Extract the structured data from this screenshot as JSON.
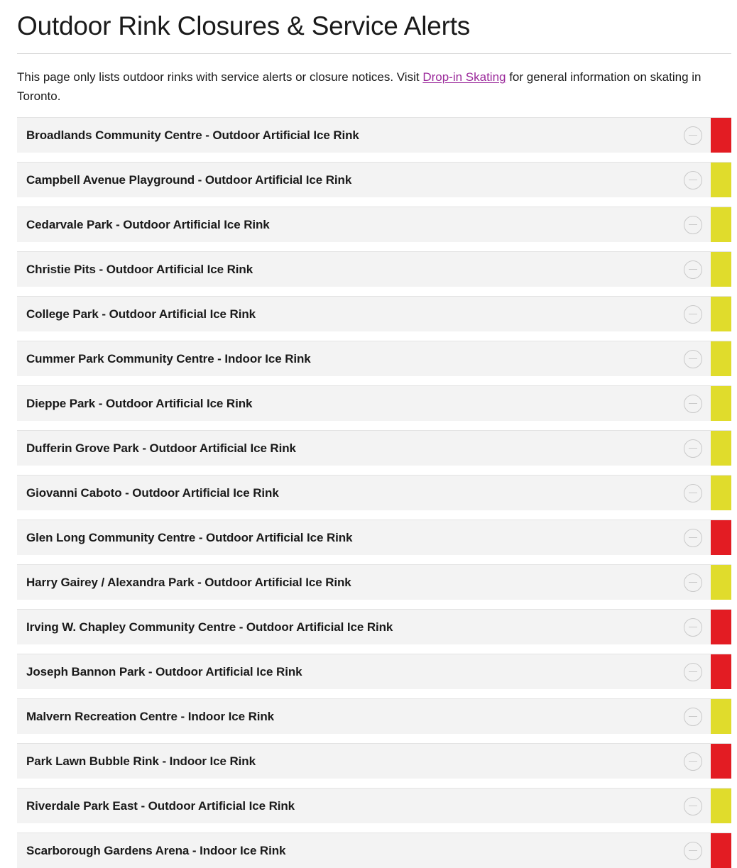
{
  "header": {
    "title": "Outdoor Rink Closures & Service Alerts"
  },
  "intro": {
    "text_before": "This page only lists outdoor rinks with service alerts or closure notices. Visit ",
    "link_label": "Drop-in Skating",
    "text_after": " for general information on skating in Toronto."
  },
  "colors": {
    "red": "#e31c23",
    "yellow": "#e0dc2c",
    "link": "#9b2a9b",
    "row_background": "#f3f3f3",
    "page_background": "#ffffff"
  },
  "icons": {
    "collapse": "minus-circle-icon"
  },
  "rinks": [
    {
      "name": "Broadlands Community Centre - Outdoor Artificial Ice Rink",
      "status": "red"
    },
    {
      "name": "Campbell Avenue Playground - Outdoor Artificial Ice Rink",
      "status": "yellow"
    },
    {
      "name": "Cedarvale Park - Outdoor Artificial Ice Rink",
      "status": "yellow"
    },
    {
      "name": "Christie Pits - Outdoor Artificial Ice Rink",
      "status": "yellow"
    },
    {
      "name": "College Park - Outdoor Artificial Ice Rink",
      "status": "yellow"
    },
    {
      "name": "Cummer Park Community Centre - Indoor Ice Rink",
      "status": "yellow"
    },
    {
      "name": "Dieppe Park - Outdoor Artificial Ice Rink",
      "status": "yellow"
    },
    {
      "name": "Dufferin Grove Park - Outdoor Artificial Ice Rink",
      "status": "yellow"
    },
    {
      "name": "Giovanni Caboto - Outdoor Artificial Ice Rink",
      "status": "yellow"
    },
    {
      "name": "Glen Long Community Centre - Outdoor Artificial Ice Rink",
      "status": "red"
    },
    {
      "name": "Harry Gairey / Alexandra Park - Outdoor Artificial Ice Rink",
      "status": "yellow"
    },
    {
      "name": "Irving W. Chapley Community Centre - Outdoor Artificial Ice Rink",
      "status": "red"
    },
    {
      "name": "Joseph Bannon Park - Outdoor Artificial Ice Rink",
      "status": "red"
    },
    {
      "name": "Malvern Recreation Centre - Indoor Ice Rink",
      "status": "yellow"
    },
    {
      "name": "Park Lawn Bubble Rink - Indoor Ice Rink",
      "status": "red"
    },
    {
      "name": "Riverdale Park East - Outdoor Artificial Ice Rink",
      "status": "yellow"
    },
    {
      "name": "Scarborough Gardens Arena - Indoor Ice Rink",
      "status": "red"
    }
  ]
}
